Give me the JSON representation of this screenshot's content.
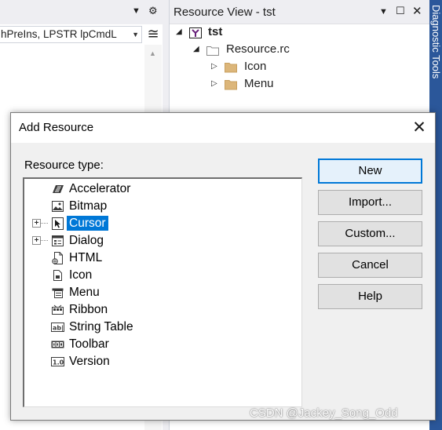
{
  "editor": {
    "function_combo": "hPreIns, LPSTR lpCmdL",
    "split_glyph": "≅"
  },
  "resource_view": {
    "title": "Resource View - tst",
    "tree": [
      {
        "label": "tst",
        "toggle": "◢",
        "icon": "project-icon"
      },
      {
        "label": "Resource.rc",
        "toggle": "◢",
        "icon": "folder-open-icon"
      },
      {
        "label": "Icon",
        "toggle": "▷",
        "icon": "folder-icon"
      },
      {
        "label": "Menu",
        "toggle": "▷",
        "icon": "folder-icon"
      }
    ]
  },
  "side_tab": {
    "label": "Diagnostic Tools"
  },
  "dialog": {
    "title": "Add Resource",
    "close_glyph": "✕",
    "resource_type_label": "Resource type:",
    "resource_types": [
      {
        "label": "Accelerator",
        "icon": "accelerator-icon",
        "expandable": false,
        "selected": false
      },
      {
        "label": "Bitmap",
        "icon": "bitmap-icon",
        "expandable": false,
        "selected": false
      },
      {
        "label": "Cursor",
        "icon": "cursor-icon",
        "expandable": true,
        "selected": true
      },
      {
        "label": "Dialog",
        "icon": "dialog-icon",
        "expandable": true,
        "selected": false
      },
      {
        "label": "HTML",
        "icon": "html-icon",
        "expandable": false,
        "selected": false
      },
      {
        "label": "Icon",
        "icon": "icon-resource-icon",
        "expandable": false,
        "selected": false
      },
      {
        "label": "Menu",
        "icon": "menu-icon",
        "expandable": false,
        "selected": false
      },
      {
        "label": "Ribbon",
        "icon": "ribbon-icon",
        "expandable": false,
        "selected": false
      },
      {
        "label": "String Table",
        "icon": "string-table-icon",
        "expandable": false,
        "selected": false
      },
      {
        "label": "Toolbar",
        "icon": "toolbar-icon",
        "expandable": false,
        "selected": false
      },
      {
        "label": "Version",
        "icon": "version-icon",
        "expandable": false,
        "selected": false
      }
    ],
    "buttons": {
      "new": "New",
      "import": "Import...",
      "custom": "Custom...",
      "cancel": "Cancel",
      "help": "Help"
    }
  },
  "watermark": "CSDN @Jackey_Song_Odd",
  "colors": {
    "selection": "#0078d7",
    "side_tab": "#2b579a",
    "folder": "#dcb67a"
  }
}
